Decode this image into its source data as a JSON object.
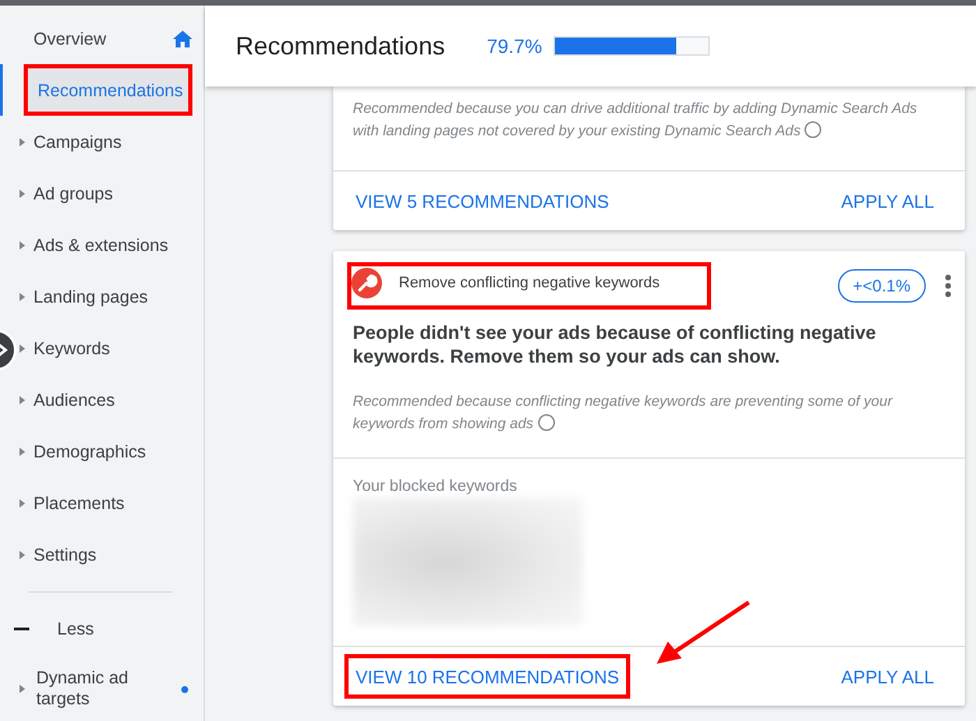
{
  "sidebar": {
    "items": [
      {
        "label": "Overview",
        "kind": "home",
        "selected": false,
        "annotated": false
      },
      {
        "label": "Recommendations",
        "kind": "plain",
        "selected": true,
        "annotated": true
      },
      {
        "label": "Campaigns",
        "kind": "expandable",
        "selected": false,
        "annotated": false
      },
      {
        "label": "Ad groups",
        "kind": "expandable",
        "selected": false,
        "annotated": false
      },
      {
        "label": "Ads & extensions",
        "kind": "expandable",
        "selected": false,
        "annotated": false
      },
      {
        "label": "Landing pages",
        "kind": "expandable",
        "selected": false,
        "annotated": false
      },
      {
        "label": "Keywords",
        "kind": "expandable",
        "selected": false,
        "annotated": false
      },
      {
        "label": "Audiences",
        "kind": "expandable",
        "selected": false,
        "annotated": false
      },
      {
        "label": "Demographics",
        "kind": "expandable",
        "selected": false,
        "annotated": false
      },
      {
        "label": "Placements",
        "kind": "expandable",
        "selected": false,
        "annotated": false
      },
      {
        "label": "Settings",
        "kind": "expandable",
        "selected": false,
        "annotated": false
      }
    ],
    "less_toggle": {
      "label": "Less"
    },
    "extra_items": [
      {
        "label": "Dynamic ad targets",
        "has_dot": true
      }
    ]
  },
  "header": {
    "title": "Recommendations",
    "score": "79.7%",
    "level": 0.797
  },
  "cards": [
    {
      "kind": "partial",
      "reason": "Recommended because you can drive additional traffic by adding Dynamic Search Ads with landing pages not covered by your existing Dynamic Search Ads",
      "view_button": "VIEW 5 RECOMMENDATIONS",
      "apply_button": "APPLY ALL",
      "annotated_view": false
    },
    {
      "kind": "full",
      "title": "Remove conflicting negative keywords",
      "uplift": "+<0.1%",
      "headline": "People didn't see your ads because of conflicting negative keywords. Remove them so your ads can show.",
      "reason": "Recommended because conflicting negative keywords are preventing some of your keywords from showing ads",
      "detail_label": "Your blocked keywords",
      "view_button": "VIEW 10 RECOMMENDATIONS",
      "apply_button": "APPLY ALL",
      "annotated_title": true,
      "annotated_view": true,
      "arrow": true
    }
  ]
}
